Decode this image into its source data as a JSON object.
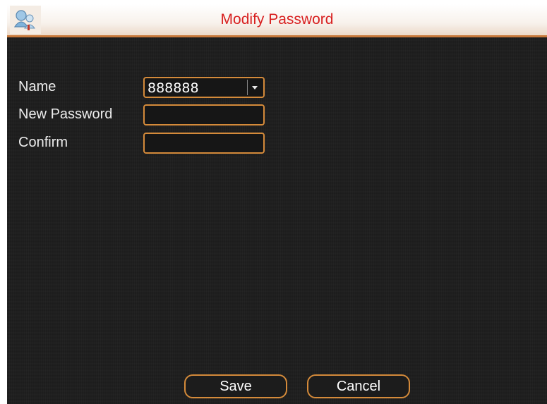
{
  "dialog": {
    "title": "Modify Password",
    "icon": "network-users-icon"
  },
  "form": {
    "name_label": "Name",
    "name_value": "888888",
    "new_password_label": "New Password",
    "new_password_value": "",
    "confirm_label": "Confirm",
    "confirm_value": ""
  },
  "buttons": {
    "save_label": "Save",
    "cancel_label": "Cancel"
  },
  "colors": {
    "title": "#d82020",
    "accent_border": "#d48a3a",
    "background": "#202020"
  }
}
